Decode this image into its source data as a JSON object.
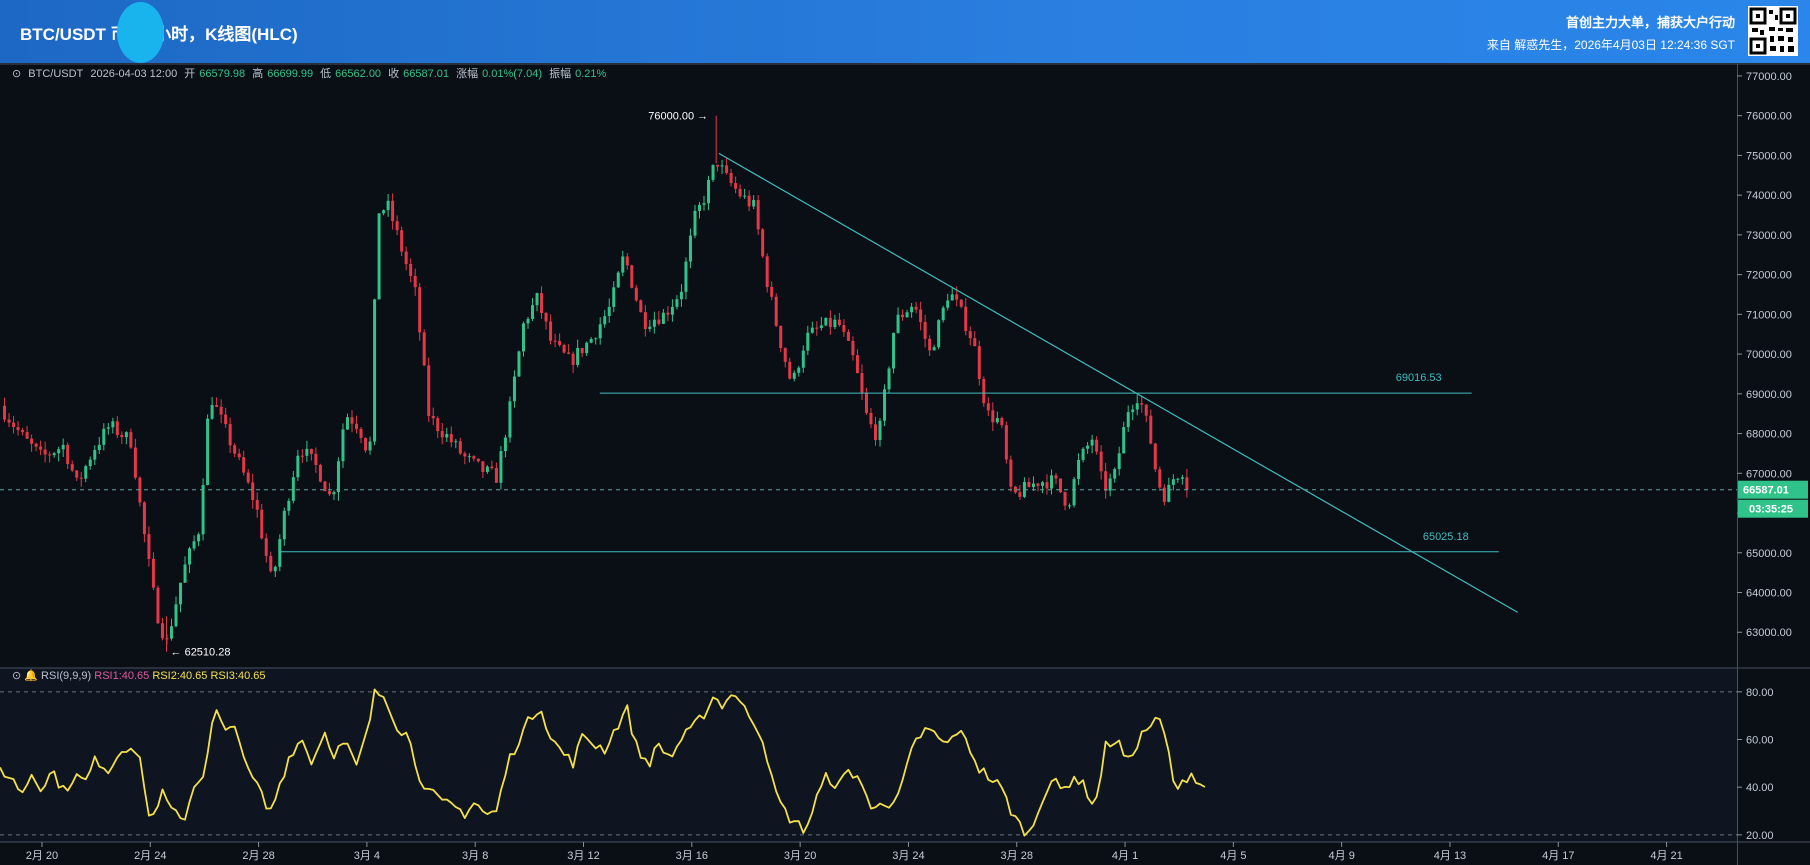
{
  "header": {
    "title": "BTC/USDT 币安4小时，K线图(HLC)",
    "slogan": "首创主力大单，捕获大户行动",
    "source": "来自 解惑先生，2026年4月03日 12:24:36 SGT"
  },
  "info": {
    "pair": "BTC/USDT",
    "datetime": "2026-04-03 12:00",
    "open_label": "开",
    "open": "66579.98",
    "high_label": "高",
    "high": "66699.99",
    "low_label": "低",
    "low": "66562.00",
    "close_label": "收",
    "close": "66587.01",
    "change_label": "涨幅",
    "change": "0.01%(7.04)",
    "amp_label": "振幅",
    "amp": "0.21%"
  },
  "rsi_header": {
    "name": "RSI(9,9,9)",
    "rsi1": "RSI1:40.65",
    "rsi2": "RSI2:40.65",
    "rsi3": "RSI3:40.65"
  },
  "colors": {
    "up": "#2fc38a",
    "down": "#e4384a",
    "trend": "#3fbdbd",
    "rsi": "#f3e04a",
    "price_tag": "#2fc38a",
    "header": "#1e6fd0"
  },
  "chart_data": {
    "type": "candlestick",
    "symbol": "BTC/USDT",
    "interval": "4h",
    "y_ticks": [
      "77000.00",
      "76000.00",
      "75000.00",
      "74000.00",
      "73000.00",
      "72000.00",
      "71000.00",
      "70000.00",
      "69000.00",
      "68000.00",
      "67000.00",
      "66000.00",
      "65000.00",
      "64000.00",
      "63000.00"
    ],
    "ylim": [
      62100,
      77300
    ],
    "x_ticks": [
      "2月 20",
      "2月 24",
      "2月 28",
      "3月 4",
      "3月 8",
      "3月 12",
      "3月 16",
      "3月 20",
      "3月 24",
      "3月 28",
      "4月 1",
      "4月 5",
      "4月 9",
      "4月 13",
      "4月 17",
      "4月 21"
    ],
    "x_tick_days": [
      0,
      4,
      8,
      12,
      16,
      20,
      24,
      28,
      32,
      36,
      40,
      44,
      48,
      52,
      56,
      60
    ],
    "x_range_days": [
      -1.55,
      62.6
    ],
    "candles_per_day": 6,
    "close_path": [
      [
        -1.55,
        68700
      ],
      [
        -0.7,
        67900
      ],
      [
        0,
        67400
      ],
      [
        0.8,
        67700
      ],
      [
        1.3,
        66700
      ],
      [
        1.9,
        67600
      ],
      [
        2.5,
        68200
      ],
      [
        3.3,
        67800
      ],
      [
        3.7,
        65800
      ],
      [
        4.2,
        63600
      ],
      [
        4.6,
        62700
      ],
      [
        5.2,
        64500
      ],
      [
        5.8,
        65600
      ],
      [
        6.2,
        69000
      ],
      [
        6.7,
        68200
      ],
      [
        7.2,
        67400
      ],
      [
        7.9,
        66200
      ],
      [
        8.5,
        64200
      ],
      [
        8.9,
        65800
      ],
      [
        9.5,
        67700
      ],
      [
        10.2,
        67100
      ],
      [
        10.7,
        66300
      ],
      [
        11.2,
        68500
      ],
      [
        11.7,
        68200
      ],
      [
        12.1,
        67400
      ],
      [
        12.4,
        73600
      ],
      [
        12.8,
        73700
      ],
      [
        13.3,
        72600
      ],
      [
        13.8,
        71500
      ],
      [
        14.3,
        68400
      ],
      [
        15.0,
        67900
      ],
      [
        15.6,
        67400
      ],
      [
        16.2,
        67100
      ],
      [
        16.8,
        66900
      ],
      [
        17.3,
        68700
      ],
      [
        17.8,
        70800
      ],
      [
        18.3,
        71400
      ],
      [
        18.8,
        70300
      ],
      [
        19.5,
        69800
      ],
      [
        20.3,
        70400
      ],
      [
        21.0,
        71200
      ],
      [
        21.5,
        72500
      ],
      [
        22.2,
        70800
      ],
      [
        23.0,
        71000
      ],
      [
        23.6,
        71600
      ],
      [
        24.1,
        73400
      ],
      [
        24.5,
        74000
      ],
      [
        24.9,
        74900
      ],
      [
        25.3,
        74400
      ],
      [
        25.8,
        74000
      ],
      [
        26.3,
        73700
      ],
      [
        26.7,
        72100
      ],
      [
        27.2,
        70500
      ],
      [
        27.7,
        69200
      ],
      [
        28.2,
        70400
      ],
      [
        28.8,
        70700
      ],
      [
        29.4,
        70800
      ],
      [
        30.0,
        69800
      ],
      [
        30.5,
        68300
      ],
      [
        30.9,
        67900
      ],
      [
        31.5,
        70800
      ],
      [
        32.2,
        71300
      ],
      [
        32.8,
        70000
      ],
      [
        33.5,
        71600
      ],
      [
        33.9,
        71100
      ],
      [
        34.4,
        70300
      ],
      [
        34.9,
        68500
      ],
      [
        35.4,
        68300
      ],
      [
        35.8,
        66400
      ],
      [
        36.3,
        66600
      ],
      [
        36.8,
        66800
      ],
      [
        37.4,
        66800
      ],
      [
        37.9,
        66200
      ],
      [
        38.3,
        67300
      ],
      [
        38.8,
        67900
      ],
      [
        39.2,
        66600
      ],
      [
        39.6,
        66900
      ],
      [
        40.1,
        68600
      ],
      [
        40.5,
        69000
      ],
      [
        40.9,
        68000
      ],
      [
        41.2,
        66800
      ],
      [
        41.5,
        66400
      ],
      [
        41.8,
        66900
      ],
      [
        42.1,
        67100
      ],
      [
        42.4,
        66587
      ]
    ],
    "annotations": {
      "high": {
        "day": 24.9,
        "price": 76000.0,
        "label": "76000.00 →"
      },
      "low": {
        "day": 4.6,
        "price": 62510.28,
        "label": "← 62510.28"
      }
    },
    "horizontal_lines": [
      {
        "price": 69016.53,
        "label": "69016.53",
        "start_day": 20.6,
        "end_day": 52.8
      },
      {
        "price": 65025.18,
        "label": "65025.18",
        "start_day": 8.8,
        "end_day": 53.8
      }
    ],
    "trendline": {
      "start": {
        "day": 25.0,
        "price": 75050
      },
      "end": {
        "day": 54.5,
        "price": 63500
      }
    },
    "current_price": {
      "price": 66587.01,
      "label": "66587.01",
      "countdown": "03:35:25"
    },
    "rsi": {
      "name": "RSI(9,9,9)",
      "ylim": [
        17,
        90
      ],
      "y_ticks": [
        "80.00",
        "60.00",
        "40.00",
        "20.00"
      ],
      "levels": [
        80,
        20
      ],
      "path": [
        [
          -1.55,
          48
        ],
        [
          -1.1,
          43
        ],
        [
          -0.7,
          38
        ],
        [
          -0.4,
          46
        ],
        [
          0.0,
          40
        ],
        [
          0.4,
          47
        ],
        [
          0.8,
          38
        ],
        [
          1.2,
          45
        ],
        [
          1.6,
          42
        ],
        [
          2.0,
          52
        ],
        [
          2.5,
          47
        ],
        [
          2.9,
          56
        ],
        [
          3.3,
          58
        ],
        [
          3.7,
          48
        ],
        [
          4.0,
          24
        ],
        [
          4.4,
          38
        ],
        [
          4.8,
          30
        ],
        [
          5.2,
          25
        ],
        [
          5.6,
          40
        ],
        [
          6.0,
          47
        ],
        [
          6.4,
          73
        ],
        [
          6.8,
          62
        ],
        [
          7.2,
          66
        ],
        [
          7.6,
          46
        ],
        [
          8.0,
          40
        ],
        [
          8.4,
          28
        ],
        [
          8.8,
          42
        ],
        [
          9.2,
          55
        ],
        [
          9.6,
          60
        ],
        [
          10.0,
          50
        ],
        [
          10.4,
          64
        ],
        [
          10.8,
          54
        ],
        [
          11.2,
          59
        ],
        [
          11.6,
          48
        ],
        [
          12.0,
          62
        ],
        [
          12.3,
          80
        ],
        [
          12.7,
          78
        ],
        [
          13.1,
          66
        ],
        [
          13.5,
          62
        ],
        [
          13.9,
          46
        ],
        [
          14.3,
          38
        ],
        [
          14.8,
          33
        ],
        [
          15.2,
          32
        ],
        [
          15.6,
          29
        ],
        [
          16.0,
          34
        ],
        [
          16.4,
          28
        ],
        [
          16.8,
          30
        ],
        [
          17.2,
          50
        ],
        [
          17.6,
          60
        ],
        [
          18.0,
          68
        ],
        [
          18.4,
          75
        ],
        [
          18.8,
          60
        ],
        [
          19.2,
          55
        ],
        [
          19.6,
          50
        ],
        [
          20.0,
          62
        ],
        [
          20.4,
          58
        ],
        [
          20.8,
          56
        ],
        [
          21.2,
          65
        ],
        [
          21.6,
          73
        ],
        [
          22.0,
          55
        ],
        [
          22.4,
          50
        ],
        [
          22.8,
          58
        ],
        [
          23.2,
          52
        ],
        [
          23.6,
          60
        ],
        [
          24.0,
          64
        ],
        [
          24.4,
          70
        ],
        [
          24.8,
          78
        ],
        [
          25.2,
          74
        ],
        [
          25.5,
          81
        ],
        [
          25.9,
          73
        ],
        [
          26.3,
          68
        ],
        [
          26.7,
          58
        ],
        [
          27.0,
          40
        ],
        [
          27.4,
          30
        ],
        [
          27.8,
          25
        ],
        [
          28.2,
          22
        ],
        [
          28.6,
          35
        ],
        [
          29.0,
          45
        ],
        [
          29.4,
          40
        ],
        [
          29.8,
          47
        ],
        [
          30.2,
          44
        ],
        [
          30.6,
          30
        ],
        [
          31.0,
          36
        ],
        [
          31.4,
          30
        ],
        [
          31.8,
          42
        ],
        [
          32.2,
          58
        ],
        [
          32.6,
          64
        ],
        [
          33.0,
          62
        ],
        [
          33.4,
          57
        ],
        [
          33.8,
          64
        ],
        [
          34.2,
          58
        ],
        [
          34.6,
          48
        ],
        [
          35.0,
          44
        ],
        [
          35.4,
          40
        ],
        [
          35.8,
          30
        ],
        [
          36.1,
          24
        ],
        [
          36.5,
          20
        ],
        [
          36.9,
          35
        ],
        [
          37.3,
          43
        ],
        [
          37.7,
          38
        ],
        [
          38.1,
          45
        ],
        [
          38.5,
          40
        ],
        [
          38.9,
          32
        ],
        [
          39.3,
          58
        ],
        [
          39.7,
          60
        ],
        [
          40.1,
          50
        ],
        [
          40.5,
          60
        ],
        [
          40.9,
          66
        ],
        [
          41.3,
          68
        ],
        [
          41.6,
          55
        ],
        [
          41.9,
          36
        ],
        [
          42.2,
          44
        ],
        [
          42.5,
          46
        ],
        [
          42.8,
          41
        ],
        [
          43.1,
          40.65
        ]
      ]
    }
  }
}
